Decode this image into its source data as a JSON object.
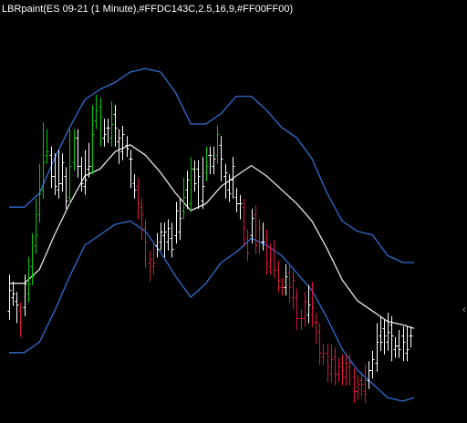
{
  "title": "LBRpaint(ES 09-21 (1 Minute),#FFDC143C,2.5,16,9,#FF00FF00)",
  "colors": {
    "background": "#000000",
    "up_bar": "#00cc00",
    "down_bar": "#dc143c",
    "neutral_bar": "#ffffff",
    "middle_line": "#e8e8e8",
    "band": "#2f6fd0"
  },
  "chart_data": {
    "type": "line",
    "title": "LBRpaint(ES 09-21 (1 Minute),#FFDC143C,2.5,16,9,#FF00FF00)",
    "xlabel": "",
    "ylabel": "",
    "grid": false,
    "legend": "none",
    "ylim": [
      1,
      0
    ],
    "x_range": [
      0,
      107
    ],
    "series": [
      {
        "values": [
          [
            0,
            0.44
          ],
          [
            4,
            0.44
          ],
          [
            8,
            0.4
          ],
          [
            12,
            0.3
          ],
          [
            16,
            0.21
          ],
          [
            20,
            0.13
          ],
          [
            24,
            0.1
          ],
          [
            28,
            0.08
          ],
          [
            32,
            0.05
          ],
          [
            36,
            0.04
          ],
          [
            40,
            0.05
          ],
          [
            44,
            0.11
          ],
          [
            48,
            0.2
          ],
          [
            52,
            0.2
          ],
          [
            56,
            0.17
          ],
          [
            60,
            0.12
          ],
          [
            64,
            0.12
          ],
          [
            68,
            0.16
          ],
          [
            72,
            0.21
          ],
          [
            76,
            0.24
          ],
          [
            80,
            0.3
          ],
          [
            84,
            0.4
          ],
          [
            88,
            0.48
          ],
          [
            92,
            0.51
          ],
          [
            96,
            0.52
          ],
          [
            100,
            0.58
          ],
          [
            104,
            0.6
          ],
          [
            107,
            0.6
          ]
        ]
      },
      {
        "values": [
          [
            0,
            0.66
          ],
          [
            4,
            0.66
          ],
          [
            8,
            0.62
          ],
          [
            12,
            0.52
          ],
          [
            16,
            0.43
          ],
          [
            20,
            0.35
          ],
          [
            24,
            0.33
          ],
          [
            28,
            0.28
          ],
          [
            32,
            0.26
          ],
          [
            36,
            0.29
          ],
          [
            40,
            0.34
          ],
          [
            44,
            0.4
          ],
          [
            48,
            0.45
          ],
          [
            52,
            0.43
          ],
          [
            56,
            0.38
          ],
          [
            60,
            0.35
          ],
          [
            64,
            0.32
          ],
          [
            68,
            0.35
          ],
          [
            72,
            0.39
          ],
          [
            76,
            0.43
          ],
          [
            80,
            0.48
          ],
          [
            84,
            0.56
          ],
          [
            88,
            0.65
          ],
          [
            92,
            0.71
          ],
          [
            96,
            0.74
          ],
          [
            100,
            0.77
          ],
          [
            104,
            0.78
          ],
          [
            107,
            0.79
          ]
        ]
      },
      {
        "values": [
          [
            0,
            0.86
          ],
          [
            4,
            0.86
          ],
          [
            8,
            0.83
          ],
          [
            12,
            0.74
          ],
          [
            16,
            0.64
          ],
          [
            20,
            0.55
          ],
          [
            24,
            0.52
          ],
          [
            28,
            0.49
          ],
          [
            32,
            0.48
          ],
          [
            36,
            0.51
          ],
          [
            40,
            0.57
          ],
          [
            44,
            0.64
          ],
          [
            48,
            0.7
          ],
          [
            52,
            0.66
          ],
          [
            56,
            0.6
          ],
          [
            60,
            0.57
          ],
          [
            64,
            0.53
          ],
          [
            68,
            0.55
          ],
          [
            72,
            0.58
          ],
          [
            76,
            0.63
          ],
          [
            80,
            0.68
          ],
          [
            84,
            0.76
          ],
          [
            88,
            0.85
          ],
          [
            92,
            0.91
          ],
          [
            96,
            0.95
          ],
          [
            100,
            0.99
          ],
          [
            104,
            1.0
          ],
          [
            107,
            0.99
          ]
        ]
      }
    ],
    "bars": [
      [
        0,
        0.74,
        0.68,
        0.66,
        "w"
      ],
      [
        1,
        0.7,
        0.69,
        0.68,
        "w"
      ],
      [
        2,
        0.71,
        0.72,
        0.75,
        "w"
      ],
      [
        3,
        0.74,
        0.77,
        0.79,
        "r"
      ],
      [
        4,
        0.73,
        0.66,
        0.66,
        "w"
      ],
      [
        5,
        0.69,
        0.66,
        0.61,
        "g"
      ],
      [
        6,
        0.61,
        0.64,
        0.54,
        "g"
      ],
      [
        7,
        0.55,
        0.52,
        0.44,
        "g"
      ],
      [
        8,
        0.46,
        0.4,
        0.34,
        "g"
      ],
      [
        9,
        0.39,
        0.31,
        0.22,
        "g"
      ],
      [
        10,
        0.29,
        0.28,
        0.24,
        "g"
      ],
      [
        11,
        0.29,
        0.35,
        0.36,
        "w"
      ],
      [
        12,
        0.35,
        0.38,
        0.31,
        "w"
      ],
      [
        13,
        0.39,
        0.37,
        0.3,
        "w"
      ],
      [
        14,
        0.37,
        0.31,
        0.37,
        "w"
      ],
      [
        15,
        0.35,
        0.42,
        0.39,
        "w"
      ],
      [
        16,
        0.41,
        0.32,
        0.24,
        "g"
      ],
      [
        17,
        0.31,
        0.24,
        0.26,
        "g"
      ],
      [
        18,
        0.24,
        0.32,
        0.33,
        "w"
      ],
      [
        19,
        0.32,
        0.37,
        0.33,
        "w"
      ],
      [
        20,
        0.38,
        0.36,
        0.3,
        "w"
      ],
      [
        21,
        0.33,
        0.32,
        0.28,
        "w"
      ],
      [
        22,
        0.32,
        0.23,
        0.17,
        "g"
      ],
      [
        23,
        0.19,
        0.16,
        0.14,
        "g"
      ],
      [
        24,
        0.15,
        0.18,
        0.24,
        "g"
      ],
      [
        25,
        0.24,
        0.23,
        0.21,
        "w"
      ],
      [
        26,
        0.21,
        0.21,
        0.23,
        "w"
      ],
      [
        27,
        0.24,
        0.2,
        0.16,
        "g"
      ],
      [
        28,
        0.17,
        0.21,
        0.24,
        "w"
      ],
      [
        29,
        0.25,
        0.24,
        0.29,
        "w"
      ],
      [
        30,
        0.28,
        0.23,
        0.26,
        "w"
      ],
      [
        31,
        0.26,
        0.27,
        0.26,
        "w"
      ],
      [
        32,
        0.3,
        0.3,
        0.36,
        "w"
      ],
      [
        33,
        0.37,
        0.39,
        0.37,
        "w"
      ],
      [
        34,
        0.38,
        0.43,
        0.45,
        "r"
      ],
      [
        35,
        0.44,
        0.46,
        0.51,
        "r"
      ],
      [
        36,
        0.5,
        0.54,
        0.59,
        "r"
      ],
      [
        37,
        0.6,
        0.59,
        0.63,
        "r"
      ],
      [
        38,
        0.61,
        0.6,
        0.57,
        "r"
      ],
      [
        39,
        0.55,
        0.56,
        0.54,
        "w"
      ],
      [
        40,
        0.54,
        0.51,
        0.52,
        "w"
      ],
      [
        41,
        0.52,
        0.51,
        0.56,
        "w"
      ],
      [
        42,
        0.54,
        0.5,
        0.53,
        "w"
      ],
      [
        43,
        0.53,
        0.56,
        0.51,
        "w"
      ],
      [
        44,
        0.52,
        0.45,
        0.5,
        "w"
      ],
      [
        45,
        0.51,
        0.47,
        0.44,
        "w"
      ],
      [
        46,
        0.45,
        0.41,
        0.38,
        "g"
      ],
      [
        47,
        0.39,
        0.36,
        0.42,
        "w"
      ],
      [
        48,
        0.43,
        0.33,
        0.32,
        "g"
      ],
      [
        49,
        0.33,
        0.37,
        0.33,
        "w"
      ],
      [
        50,
        0.33,
        0.35,
        0.42,
        "w"
      ],
      [
        51,
        0.42,
        0.38,
        0.32,
        "w"
      ],
      [
        52,
        0.34,
        0.32,
        0.29,
        "g"
      ],
      [
        53,
        0.29,
        0.29,
        0.32,
        "w"
      ],
      [
        54,
        0.32,
        0.3,
        0.29,
        "w"
      ],
      [
        55,
        0.29,
        0.23,
        0.26,
        "g"
      ],
      [
        56,
        0.26,
        0.3,
        0.34,
        "w"
      ],
      [
        57,
        0.35,
        0.34,
        0.39,
        "w"
      ],
      [
        58,
        0.39,
        0.4,
        0.37,
        "w"
      ],
      [
        59,
        0.36,
        0.32,
        0.39,
        "w"
      ],
      [
        60,
        0.41,
        0.43,
        0.43,
        "w"
      ],
      [
        61,
        0.43,
        0.43,
        0.45,
        "w"
      ],
      [
        62,
        0.44,
        0.5,
        0.53,
        "r"
      ],
      [
        63,
        0.53,
        0.57,
        0.53,
        "r"
      ],
      [
        64,
        0.52,
        0.47,
        0.47,
        "w"
      ],
      [
        65,
        0.46,
        0.55,
        0.53,
        "r"
      ],
      [
        66,
        0.54,
        0.5,
        0.55,
        "r"
      ],
      [
        67,
        0.54,
        0.54,
        0.51,
        "w"
      ],
      [
        68,
        0.53,
        0.6,
        0.61,
        "r"
      ],
      [
        69,
        0.61,
        0.59,
        0.57,
        "r"
      ],
      [
        70,
        0.56,
        0.62,
        0.62,
        "r"
      ],
      [
        71,
        0.62,
        0.65,
        0.66,
        "r"
      ],
      [
        72,
        0.67,
        0.67,
        0.67,
        "r"
      ],
      [
        73,
        0.67,
        0.64,
        0.63,
        "w"
      ],
      [
        74,
        0.63,
        0.67,
        0.69,
        "r"
      ],
      [
        75,
        0.7,
        0.65,
        0.71,
        "r"
      ],
      [
        76,
        0.7,
        0.76,
        0.77,
        "r"
      ],
      [
        77,
        0.76,
        0.76,
        0.77,
        "r"
      ],
      [
        78,
        0.76,
        0.71,
        0.74,
        "r"
      ],
      [
        79,
        0.75,
        0.72,
        0.69,
        "w"
      ],
      [
        80,
        0.68,
        0.73,
        0.76,
        "r"
      ],
      [
        81,
        0.77,
        0.77,
        0.81,
        "r"
      ],
      [
        82,
        0.8,
        0.86,
        0.87,
        "r"
      ],
      [
        83,
        0.87,
        0.86,
        0.86,
        "r"
      ],
      [
        84,
        0.86,
        0.9,
        0.92,
        "r"
      ],
      [
        85,
        0.92,
        0.88,
        0.86,
        "r"
      ],
      [
        86,
        0.87,
        0.92,
        0.93,
        "r"
      ],
      [
        87,
        0.92,
        0.9,
        0.91,
        "r"
      ],
      [
        88,
        0.89,
        0.91,
        0.93,
        "r"
      ],
      [
        89,
        0.93,
        0.89,
        0.89,
        "r"
      ],
      [
        90,
        0.9,
        0.89,
        0.93,
        "r"
      ],
      [
        91,
        0.93,
        0.97,
        0.98,
        "r"
      ],
      [
        92,
        0.97,
        0.95,
        0.95,
        "r"
      ],
      [
        93,
        0.94,
        0.95,
        0.96,
        "r"
      ],
      [
        94,
        0.97,
        0.98,
        0.92,
        "r"
      ],
      [
        95,
        0.94,
        0.91,
        0.91,
        "w"
      ],
      [
        96,
        0.91,
        0.88,
        0.88,
        "w"
      ],
      [
        97,
        0.89,
        0.83,
        0.8,
        "w"
      ],
      [
        98,
        0.81,
        0.83,
        0.78,
        "w"
      ],
      [
        99,
        0.79,
        0.81,
        0.84,
        "w"
      ],
      [
        100,
        0.83,
        0.8,
        0.77,
        "w"
      ],
      [
        101,
        0.78,
        0.81,
        0.86,
        "w"
      ],
      [
        102,
        0.85,
        0.84,
        0.84,
        "w"
      ],
      [
        103,
        0.84,
        0.85,
        0.82,
        "w"
      ],
      [
        104,
        0.81,
        0.83,
        0.86,
        "w"
      ],
      [
        105,
        0.86,
        0.85,
        0.81,
        "w"
      ],
      [
        106,
        0.81,
        0.81,
        0.82,
        "w"
      ]
    ]
  }
}
